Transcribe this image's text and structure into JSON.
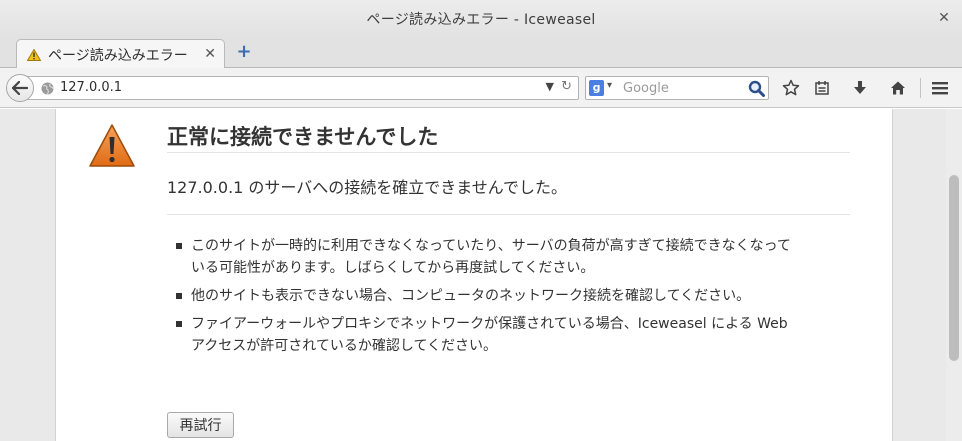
{
  "window": {
    "title": "ページ読み込みエラー  -  Iceweasel"
  },
  "tabs": [
    {
      "label": "ページ読み込みエラー"
    }
  ],
  "navbar": {
    "url": "127.0.0.1",
    "search_placeholder": "Google"
  },
  "error": {
    "title": "正常に接続できませんでした",
    "description": "127.0.0.1 のサーバへの接続を確立できませんでした。",
    "items": [
      "このサイトが一時的に利用できなくなっていたり、サーバの負荷が高すぎて接続できなくなっている可能性があります。しばらくしてから再度試してください。",
      "他のサイトも表示できない場合、コンピュータのネットワーク接続を確認してください。",
      "ファイアーウォールやプロキシでネットワークが保護されている場合、Iceweasel による Web アクセスが許可されているか確認してください。"
    ],
    "retry_label": "再試行"
  },
  "colors": {
    "warning_orange": "#e8772e",
    "search_engine_blue": "#4a7ee0"
  },
  "icons": [
    "warning-icon",
    "close-icon",
    "new-tab-icon",
    "back-icon",
    "globe-icon",
    "dropdown-icon",
    "reload-icon",
    "google-engine-icon",
    "search-icon",
    "bookmark-star-icon",
    "bookmarks-list-icon",
    "download-icon",
    "home-icon",
    "menu-icon"
  ]
}
